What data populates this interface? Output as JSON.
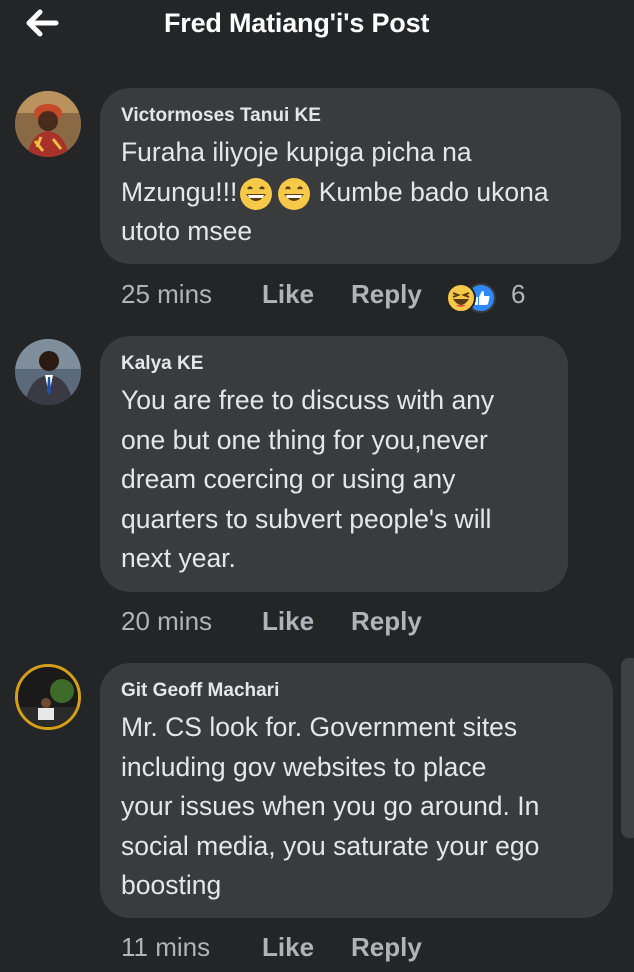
{
  "header": {
    "title": "Fred Matiang'i's Post",
    "back_icon": "arrow-left-icon"
  },
  "comments": [
    {
      "author": "Victormoses Tanui KE",
      "lines": [
        "Furaha iliyoje kupiga picha na",
        "Mzungu!!!",
        " Kumbe bado ukona",
        "utoto msee"
      ],
      "emoji": "grinning-face-emoji",
      "time": "25 mins",
      "like": "Like",
      "reply": "Reply",
      "reaction_icons": [
        "haha-reaction-icon",
        "like-reaction-icon"
      ],
      "reaction_count": "6"
    },
    {
      "author": "Kalya KE",
      "lines": [
        "You are free to discuss with any",
        "one but one thing for you,never",
        "dream coercing or using any",
        "quarters to subvert people's will",
        "next year."
      ],
      "time": "20 mins",
      "like": "Like",
      "reply": "Reply"
    },
    {
      "author": "Git Geoff Machari",
      "lines": [
        "Mr. CS look for. Government sites",
        "including gov websites to place",
        "your issues when you go around. In",
        "social media, you saturate your ego",
        "boosting"
      ],
      "time": "11 mins",
      "like": "Like",
      "reply": "Reply"
    }
  ],
  "colors": {
    "background": "#242526",
    "bubble": "#3a3b3c",
    "text": "#e4e6eb",
    "muted": "#b0b3b8"
  }
}
